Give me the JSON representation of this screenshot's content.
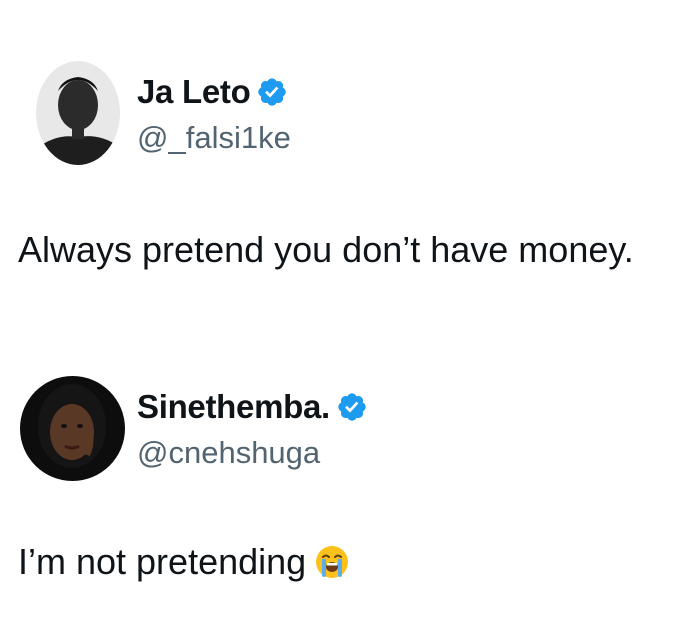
{
  "tweets": [
    {
      "display_name": "Ja Leto",
      "handle": "@_falsi1ke",
      "verified": true,
      "avatar_icon": "avatar-icon",
      "text": "Always pretend you don’t have money."
    },
    {
      "display_name": "Sinethemba.",
      "handle": "@cnehshuga",
      "verified": true,
      "avatar_icon": "avatar-icon",
      "text": "I’m not pretending",
      "trailing_emoji": "loudly-crying-face-icon"
    }
  ],
  "colors": {
    "text_primary": "#0f1419",
    "text_secondary": "#536471",
    "verified_blue": "#1d9bf0",
    "background": "#ffffff"
  }
}
